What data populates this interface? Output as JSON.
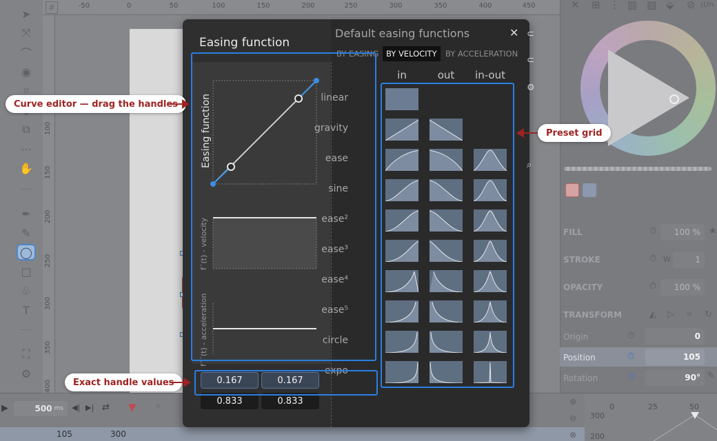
{
  "ruler": {
    "top_ticks": [
      "-50",
      "0",
      "50",
      "100",
      "150",
      "200",
      "250",
      "300",
      "350",
      "400",
      "450"
    ],
    "left_ticks": [
      "100",
      "150",
      "200",
      "250",
      "300",
      "350",
      "400"
    ]
  },
  "right_panel": {
    "fill_label": "FILL",
    "fill_value": "100 %",
    "stroke_label": "STROKE",
    "stroke_w_label": "W",
    "stroke_value": "1",
    "opacity_label": "OPACITY",
    "opacity_value": "100 %",
    "transform_label": "TRANSFORM",
    "origin_label": "Origin",
    "origin_value": "0",
    "position_label": "Position",
    "position_value": "105",
    "rotation_label": "Rotation",
    "rotation_value": "90°",
    "unlink_label": "(Un"
  },
  "timeline": {
    "duration_value": "500",
    "duration_unit": "ms",
    "pos1": "105",
    "pos2": "300",
    "graph_y_top": "300",
    "graph_y_bottom": "200",
    "graph_x": [
      "0",
      "25",
      "50"
    ]
  },
  "dialog": {
    "title": "Easing function",
    "editor_label": "Easing function",
    "velocity_label": "f´(t) - velocity",
    "acceleration_label": "f´´(t) - acceleration",
    "defaults_title": "Default easing functions",
    "tabs": [
      "BY EASING",
      "BY VELOCITY",
      "BY ACCELERATION"
    ],
    "active_tab": 1,
    "columns": [
      "in",
      "out",
      "in-out"
    ],
    "rows": [
      "linear",
      "gravity",
      "ease",
      "sine",
      "ease²",
      "ease³",
      "ease⁴",
      "ease⁵",
      "circle",
      "expo"
    ],
    "handle_values": {
      "x1": "0.167",
      "y1": "0.167",
      "x2": "0.833",
      "y2": "0.833"
    }
  },
  "callouts": {
    "curve_editor": "Curve editor — drag the handles",
    "preset_grid": "Preset grid",
    "handle_values": "Exact handle values"
  },
  "colors": {
    "highlight": "#2b7fe3",
    "callout_text": "#9e2323",
    "curve": "#3a8fe0"
  }
}
